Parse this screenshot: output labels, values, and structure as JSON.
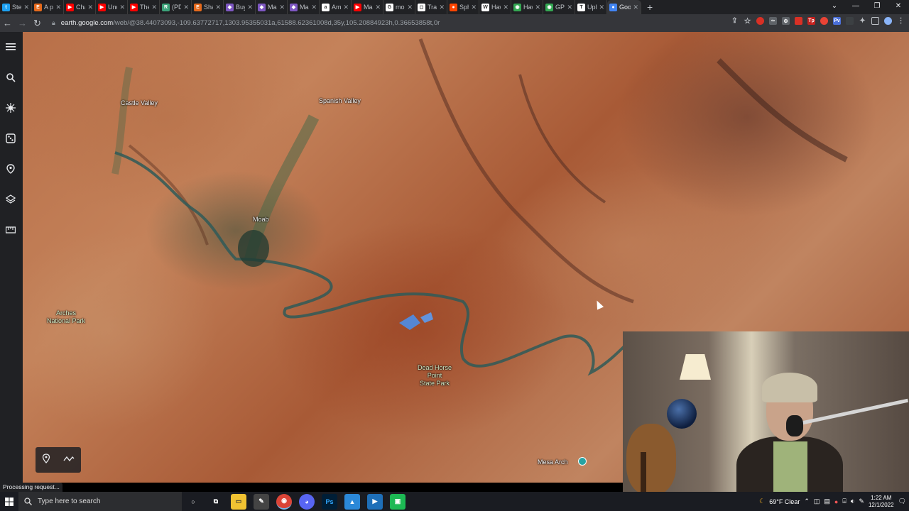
{
  "tabs": [
    {
      "label": "Ste",
      "color": "#1da1f2",
      "glyph": "t"
    },
    {
      "label": "A p",
      "color": "#e66a1c",
      "glyph": "E"
    },
    {
      "label": "Channe",
      "color": "#ff0000",
      "glyph": "▶"
    },
    {
      "label": "Underg",
      "color": "#ff0000",
      "glyph": "▶"
    },
    {
      "label": "The Ho",
      "color": "#ff0000",
      "glyph": "▶"
    },
    {
      "label": "(PDF) A",
      "color": "#3ca37a",
      "glyph": "R"
    },
    {
      "label": "Shaligr",
      "color": "#e66a1c",
      "glyph": "E"
    },
    {
      "label": "Buy on",
      "color": "#7e57c2",
      "glyph": "◆"
    },
    {
      "label": "Maha A",
      "color": "#7e57c2",
      "glyph": "◆"
    },
    {
      "label": "Mahali",
      "color": "#7e57c2",
      "glyph": "◆"
    },
    {
      "label": "Amazo",
      "color": "#ffffff",
      "glyph": "a"
    },
    {
      "label": "Mauna",
      "color": "#ff0000",
      "glyph": "▶"
    },
    {
      "label": "mounta",
      "color": "#ffffff",
      "glyph": "G"
    },
    {
      "label": "Transan",
      "color": "#ffffff",
      "glyph": "◻"
    },
    {
      "label": "Sphere",
      "color": "#ff4500",
      "glyph": "●"
    },
    {
      "label": "Hawaii",
      "color": "#ffffff",
      "glyph": "W"
    },
    {
      "label": "Hawaii",
      "color": "#34a853",
      "glyph": "◉"
    },
    {
      "label": "GPlates",
      "color": "#34a853",
      "glyph": "◉"
    },
    {
      "label": "Uphea",
      "color": "#ffffff",
      "glyph": "T"
    },
    {
      "label": "Goo",
      "color": "#4285f4",
      "glyph": "●",
      "active": true
    }
  ],
  "address": {
    "host": "earth.google.com",
    "path": "/web/@38.44073093,-109.63772717,1303.95355031a,61588.62361008d,35y,105.20884923h,0.36653858t,0r"
  },
  "map_labels": {
    "castle_valley": "Castle Valley",
    "spanish_valley": "Spanish Valley",
    "moab": "Moab",
    "arches_l1": "Arches",
    "arches_l2": "National Park",
    "dead_horse_l1": "Dead Horse",
    "dead_horse_l2": "Point",
    "dead_horse_l3": "State Park",
    "mesa_arch": "Mesa Arch"
  },
  "status": "Processing request...",
  "taskbar": {
    "search_placeholder": "Type here to search",
    "weather": "69°F  Clear",
    "time": "1:22 AM",
    "date": "12/1/2022"
  },
  "colors": {
    "chrome_dark": "#202124",
    "toolbar": "#35363a",
    "taskbar": "#1a1c22"
  }
}
